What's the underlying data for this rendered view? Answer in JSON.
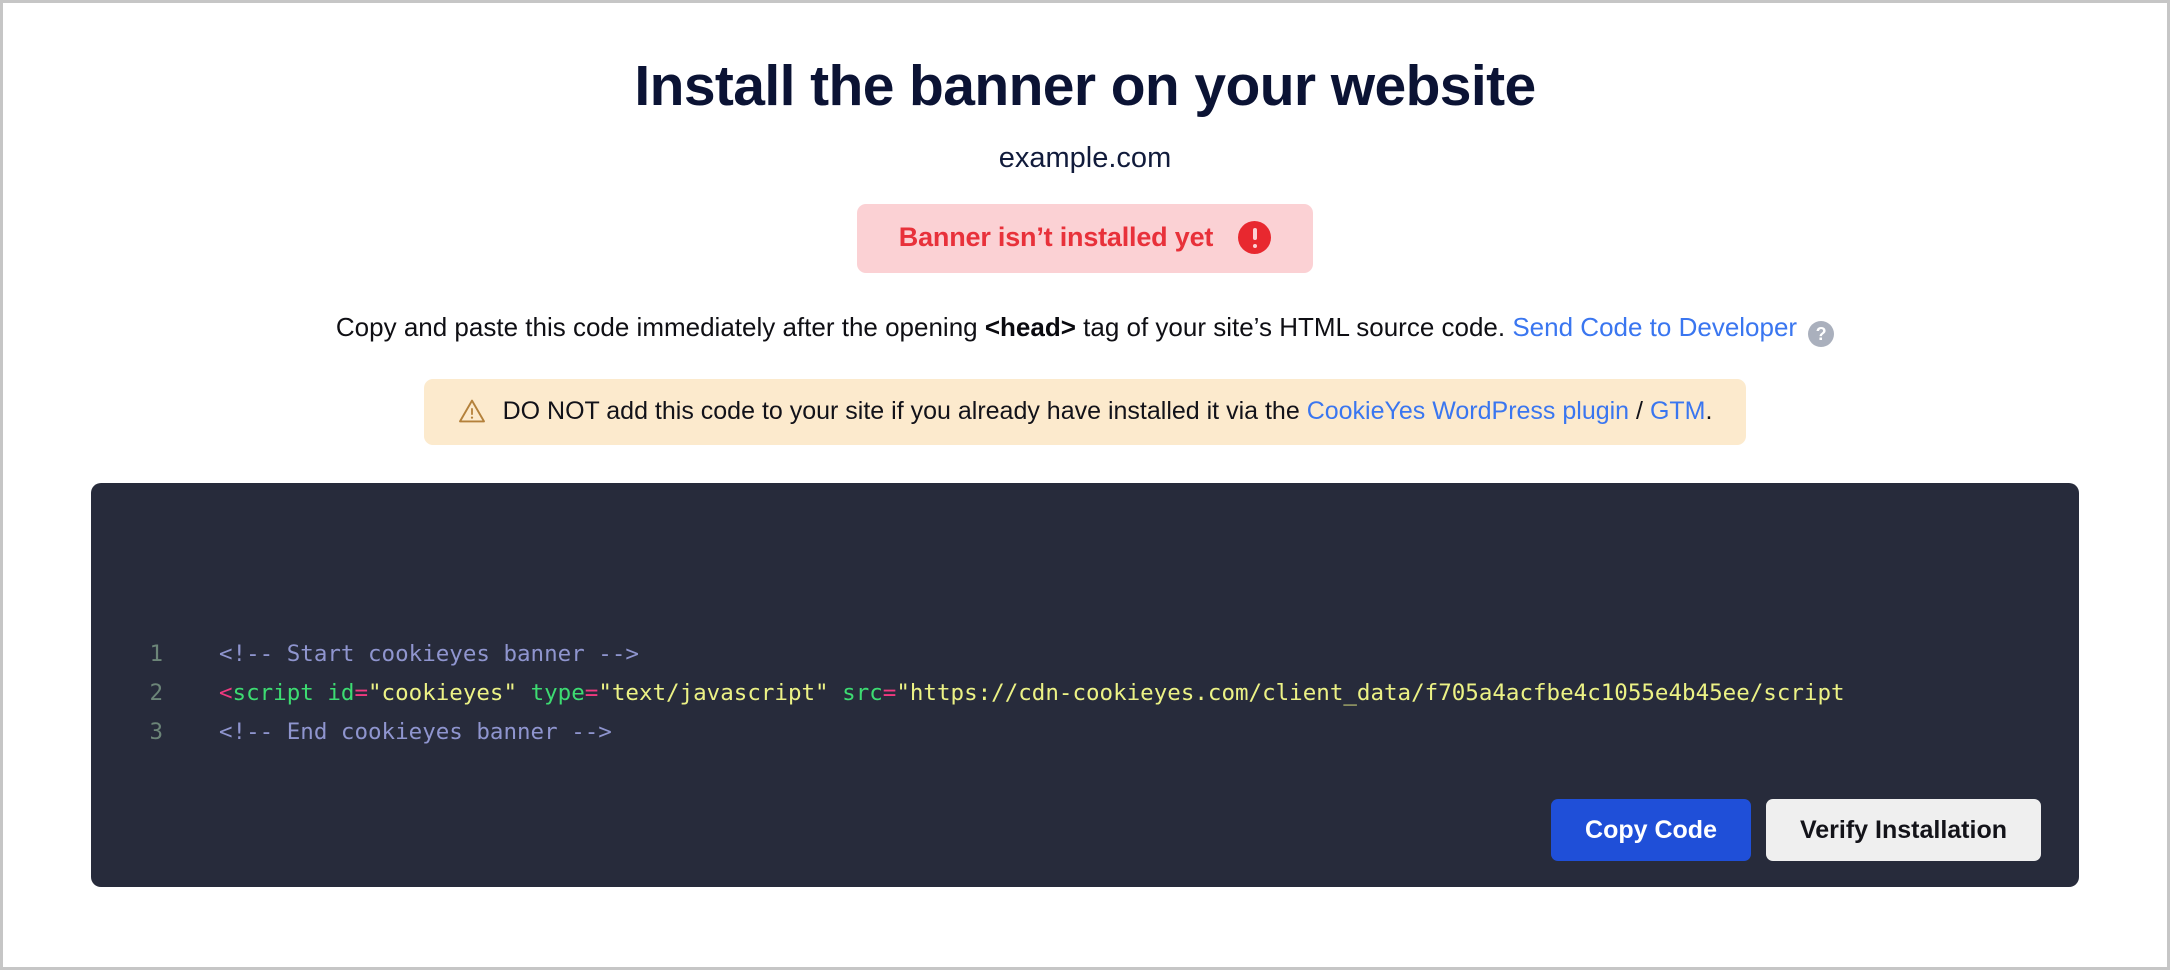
{
  "page": {
    "title": "Install the banner on your website",
    "domain": "example.com"
  },
  "status": {
    "label": "Banner isn’t installed yet",
    "icon": "alert-circle-icon",
    "bg_color": "#fbd1d4",
    "text_color": "#e8313a",
    "icon_color": "#e8282f"
  },
  "instruction": {
    "prefix": "Copy and paste this code immediately after the opening ",
    "head_tag": "<head>",
    "suffix": " tag of your site’s HTML source code. ",
    "link_label": "Send Code to Developer",
    "help_icon_glyph": "?",
    "link_color": "#3a76f0"
  },
  "warning": {
    "icon": "warning-triangle-icon",
    "text_before": "DO NOT add this code to your site if you already have installed it via the ",
    "link_plugin": "CookieYes WordPress plugin",
    "separator": " / ",
    "link_gtm": "GTM",
    "text_after": ".",
    "bg_color": "#fceacd",
    "icon_color": "#b4813b"
  },
  "code_block": {
    "bg_color": "#272b3b",
    "lines": [
      {
        "number": "1",
        "tokens": [
          {
            "type": "comment",
            "text": "<!-- Start cookieyes banner -->"
          }
        ]
      },
      {
        "number": "2",
        "tokens": [
          {
            "type": "punct",
            "text": "<"
          },
          {
            "type": "tag",
            "text": "script"
          },
          {
            "type": "plain",
            "text": " "
          },
          {
            "type": "attr",
            "text": "id"
          },
          {
            "type": "eq",
            "text": "="
          },
          {
            "type": "string",
            "text": "\"cookieyes\""
          },
          {
            "type": "plain",
            "text": " "
          },
          {
            "type": "attr",
            "text": "type"
          },
          {
            "type": "eq",
            "text": "="
          },
          {
            "type": "string",
            "text": "\"text/javascript\""
          },
          {
            "type": "plain",
            "text": " "
          },
          {
            "type": "attr",
            "text": "src"
          },
          {
            "type": "eq",
            "text": "="
          },
          {
            "type": "string",
            "text": "\"https://cdn-cookieyes.com/client_data/f705a4acfbe4c1055e4b45ee/script"
          }
        ]
      },
      {
        "number": "3",
        "tokens": [
          {
            "type": "comment",
            "text": "<!-- End cookieyes banner -->"
          }
        ]
      }
    ],
    "buttons": {
      "copy_label": "Copy Code",
      "verify_label": "Verify Installation",
      "copy_bg": "#1f4fd8",
      "verify_bg": "#efefef"
    }
  }
}
